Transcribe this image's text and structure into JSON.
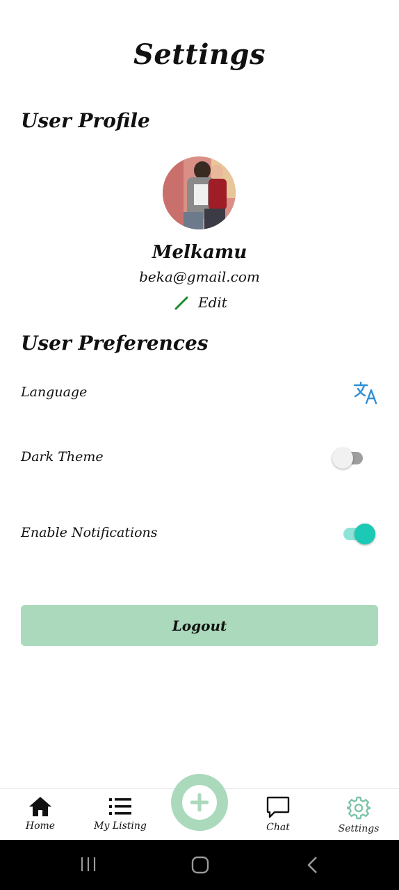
{
  "header": {
    "title": "Settings"
  },
  "profile": {
    "section_title": "User Profile",
    "name": "Melkamu",
    "email": "beka@gmail.com",
    "edit_label": "Edit"
  },
  "preferences": {
    "section_title": "User Preferences",
    "language_label": "Language",
    "dark_theme_label": "Dark Theme",
    "dark_theme_on": false,
    "notifications_label": "Enable Notifications",
    "notifications_on": true
  },
  "actions": {
    "logout_label": "Logout"
  },
  "bottom_nav": {
    "items": [
      {
        "label": "Home",
        "icon": "home-icon"
      },
      {
        "label": "My Listing",
        "icon": "list-icon"
      },
      {
        "label": "Chat",
        "icon": "chat-icon"
      },
      {
        "label": "Settings",
        "icon": "gear-icon",
        "active": true
      }
    ],
    "fab_icon": "plus-icon"
  },
  "colors": {
    "accent": "#abd9bc",
    "toggle_on": "#1bc9b4",
    "toggle_on_track": "#8ee3d8",
    "language_icon": "#2f8fd6",
    "edit_icon": "#1e8a2e",
    "settings_icon": "#7fc4a8"
  }
}
